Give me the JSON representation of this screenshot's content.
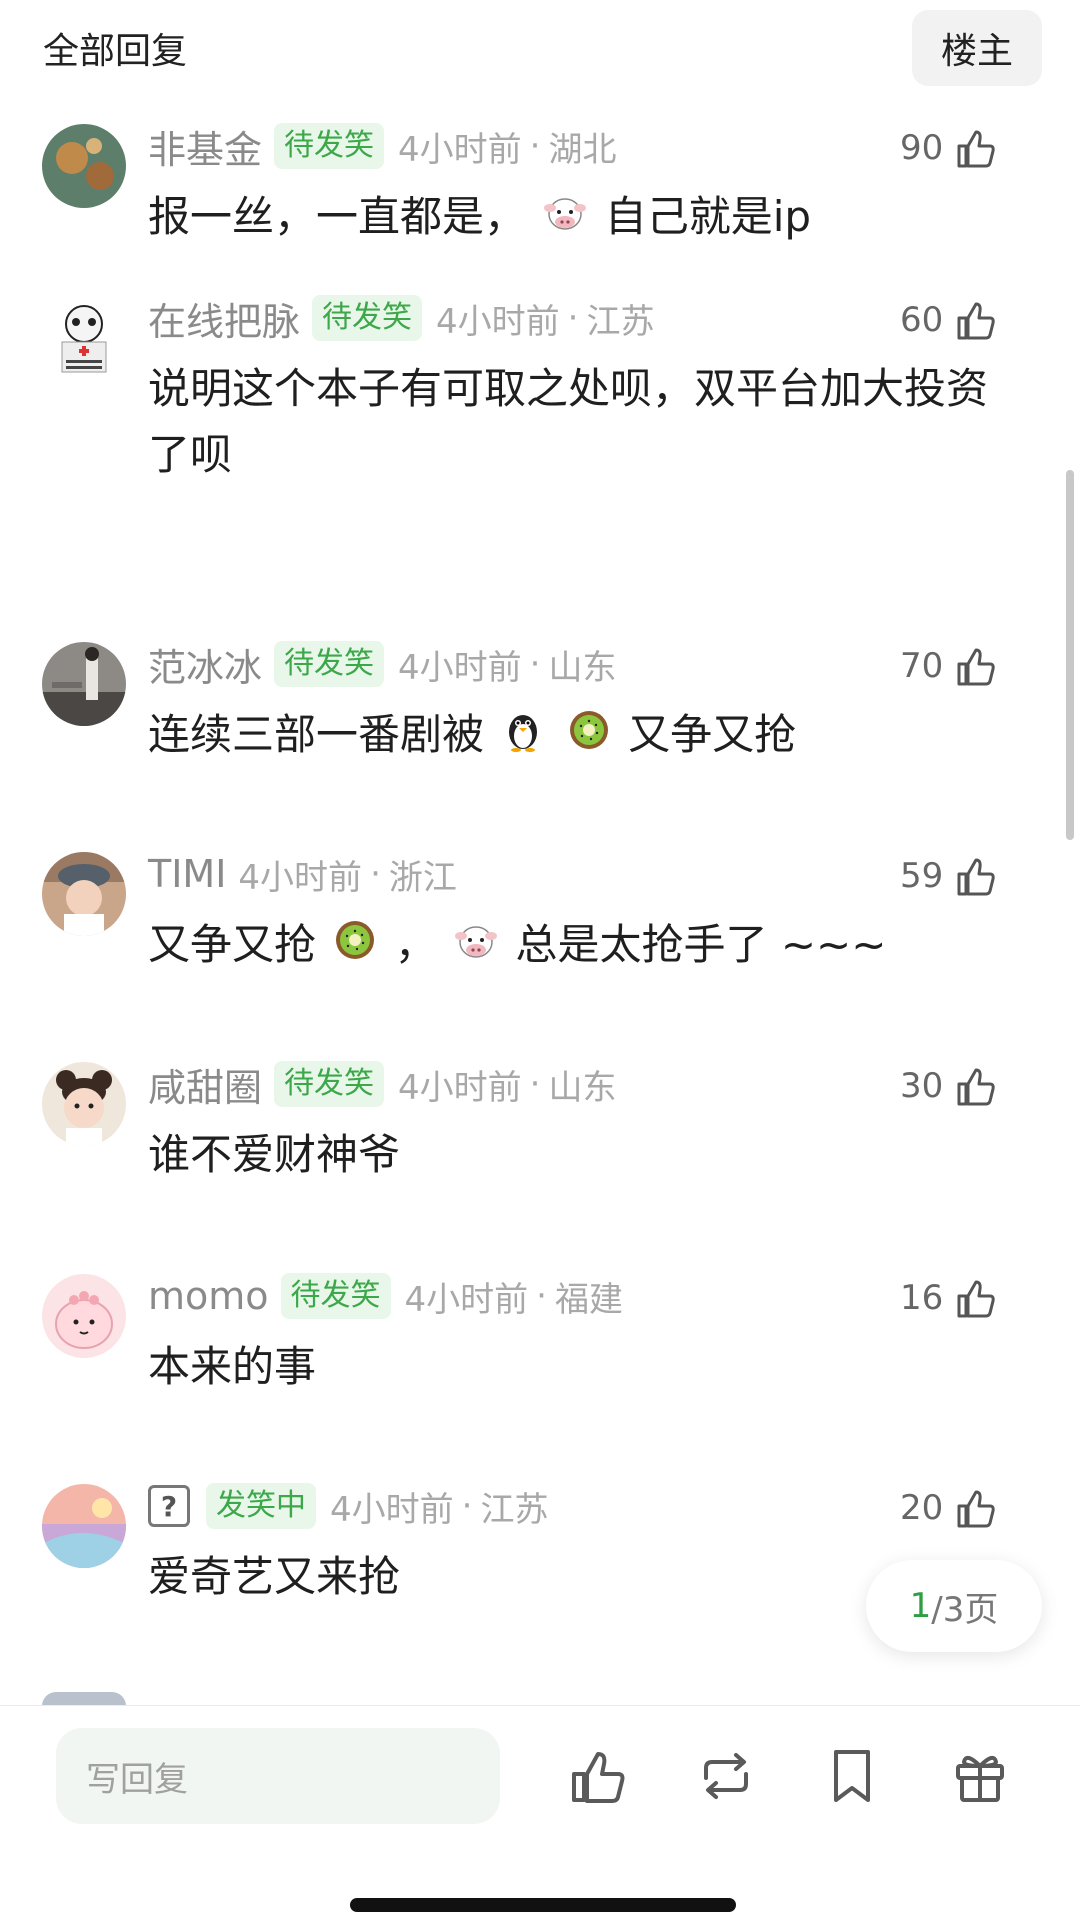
{
  "header": {
    "title": "全部回复",
    "owner_button": "楼主"
  },
  "comments": [
    {
      "user": "非基金",
      "badge": "待发笑",
      "time": "4小时前",
      "dot": "·",
      "location": "湖北",
      "likes": "90",
      "text_parts": [
        "报一丝，一直都是，",
        "自己就是ip"
      ],
      "emojis": [
        "cow-face-emoji"
      ]
    },
    {
      "user": "在线把脉",
      "badge": "待发笑",
      "time": "4小时前",
      "dot": "·",
      "location": "江苏",
      "likes": "60",
      "text": "说明这个本子有可取之处呗，双平台加大投资了呗"
    },
    {
      "user": "范冰冰",
      "badge": "待发笑",
      "time": "4小时前",
      "dot": "·",
      "location": "山东",
      "likes": "70",
      "text_parts": [
        "连续三部一番剧被",
        "又争又抢"
      ],
      "emojis": [
        "penguin-emoji",
        "kiwi-emoji"
      ]
    },
    {
      "user": "TIMI",
      "time": "4小时前",
      "dot": "·",
      "location": "浙江",
      "likes": "59",
      "text_parts": [
        "又争又抢",
        "，",
        "总是太抢手了 ~~~"
      ],
      "emojis": [
        "kiwi-emoji",
        "cow-face-emoji"
      ]
    },
    {
      "user": "咸甜圈",
      "badge": "待发笑",
      "time": "4小时前",
      "dot": "·",
      "location": "山东",
      "likes": "30",
      "text": "谁不爱财神爷"
    },
    {
      "user": "momo",
      "badge": "待发笑",
      "time": "4小时前",
      "dot": "·",
      "location": "福建",
      "likes": "16",
      "text": "本来的事"
    },
    {
      "user_icon": "?",
      "badge": "发笑中",
      "time": "4小时前",
      "dot": "·",
      "location": "江苏",
      "likes": "20",
      "text": "爱奇艺又来抢"
    }
  ],
  "pager": {
    "current": "1",
    "total": "/3页"
  },
  "bottom_bar": {
    "reply_placeholder": "写回复"
  },
  "colors": {
    "badge_green": "#3ca84a",
    "badge_bg": "#e9f7ea",
    "meta_gray": "#a8a8a8",
    "pager_green": "#2e9e43"
  }
}
